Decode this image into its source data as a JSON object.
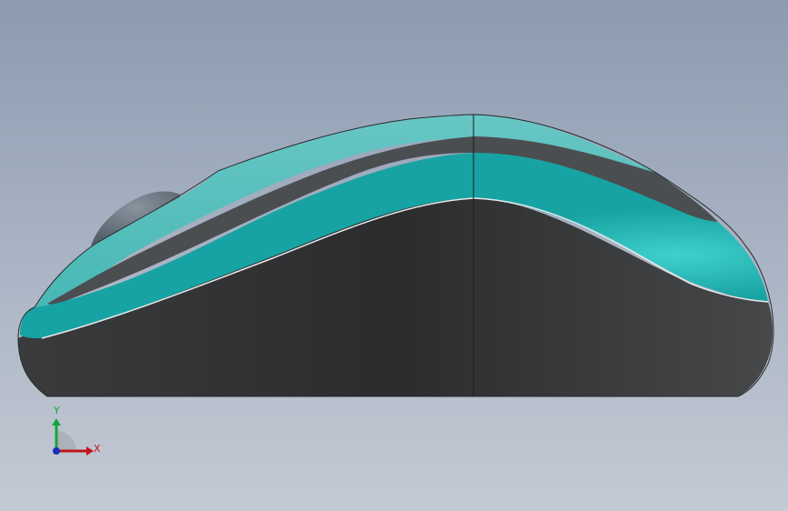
{
  "viewport": {
    "model_name": "",
    "colors": {
      "background_top": "#8c9bb0",
      "background_bottom": "#c4cad4",
      "shell_teal": "#19a7a7",
      "shell_light_teal": "#5bc3c1",
      "stripe_dark": "#4a4d4f",
      "base_dark": "#2e2f30",
      "wheel_gray": "#6a7580"
    }
  },
  "triad": {
    "x_label": "X",
    "y_label": "Y",
    "colors": {
      "x": "#c0161b",
      "y": "#12a53a",
      "z": "#1a2fb8"
    }
  }
}
